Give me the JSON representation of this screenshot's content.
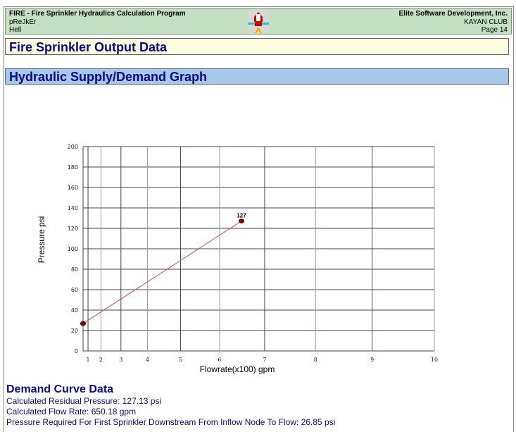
{
  "header": {
    "program": "FIRE - Fire Sprinkler Hydraulics Calculation Program",
    "project": "pReJkEr",
    "location": "Hell",
    "company": "Elite Software Development, Inc.",
    "client": "KAYAN CLUB",
    "page": "Page 14"
  },
  "title": "Fire Sprinkler Output Data",
  "section": "Hydraulic Supply/Demand Graph",
  "chart_data": {
    "type": "line",
    "title": "Hydraulic Supply/Demand Graph",
    "xlabel": "Flowrate(x100)  gpm",
    "ylabel": "Pressure  psi",
    "x_scale": "N^1.85",
    "xlim": [
      0,
      10
    ],
    "ylim": [
      0,
      200
    ],
    "xticks": [
      1,
      2,
      3,
      4,
      5,
      6,
      7,
      8,
      9,
      10
    ],
    "yticks": [
      0,
      20,
      40,
      60,
      80,
      100,
      120,
      140,
      160,
      180,
      200
    ],
    "grid": true,
    "series": [
      {
        "name": "demand",
        "color": "#8b0000",
        "points": [
          [
            0,
            26.85
          ],
          [
            6.5018,
            127.13
          ]
        ],
        "labels": [
          "",
          "127"
        ]
      }
    ]
  },
  "summary": {
    "title": "Demand Curve Data",
    "lines": [
      "Calculated Residual Pressure: 127.13 psi",
      "Calculated Flow Rate: 650.18 gpm",
      "Pressure Required For First Sprinkler Downstream From Inflow Node To Flow: 26.85 psi"
    ]
  }
}
